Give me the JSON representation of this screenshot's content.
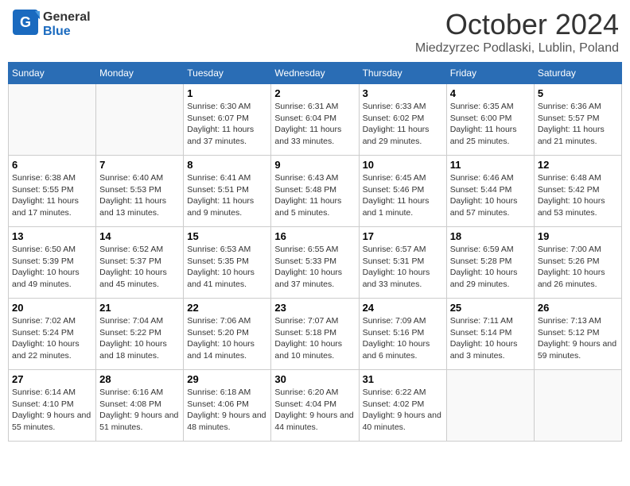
{
  "header": {
    "logo_general": "General",
    "logo_blue": "Blue",
    "month": "October 2024",
    "location": "Miedzyrzec Podlaski, Lublin, Poland"
  },
  "weekdays": [
    "Sunday",
    "Monday",
    "Tuesday",
    "Wednesday",
    "Thursday",
    "Friday",
    "Saturday"
  ],
  "weeks": [
    [
      {
        "day": "",
        "info": ""
      },
      {
        "day": "",
        "info": ""
      },
      {
        "day": "1",
        "info": "Sunrise: 6:30 AM\nSunset: 6:07 PM\nDaylight: 11 hours and 37 minutes."
      },
      {
        "day": "2",
        "info": "Sunrise: 6:31 AM\nSunset: 6:04 PM\nDaylight: 11 hours and 33 minutes."
      },
      {
        "day": "3",
        "info": "Sunrise: 6:33 AM\nSunset: 6:02 PM\nDaylight: 11 hours and 29 minutes."
      },
      {
        "day": "4",
        "info": "Sunrise: 6:35 AM\nSunset: 6:00 PM\nDaylight: 11 hours and 25 minutes."
      },
      {
        "day": "5",
        "info": "Sunrise: 6:36 AM\nSunset: 5:57 PM\nDaylight: 11 hours and 21 minutes."
      }
    ],
    [
      {
        "day": "6",
        "info": "Sunrise: 6:38 AM\nSunset: 5:55 PM\nDaylight: 11 hours and 17 minutes."
      },
      {
        "day": "7",
        "info": "Sunrise: 6:40 AM\nSunset: 5:53 PM\nDaylight: 11 hours and 13 minutes."
      },
      {
        "day": "8",
        "info": "Sunrise: 6:41 AM\nSunset: 5:51 PM\nDaylight: 11 hours and 9 minutes."
      },
      {
        "day": "9",
        "info": "Sunrise: 6:43 AM\nSunset: 5:48 PM\nDaylight: 11 hours and 5 minutes."
      },
      {
        "day": "10",
        "info": "Sunrise: 6:45 AM\nSunset: 5:46 PM\nDaylight: 11 hours and 1 minute."
      },
      {
        "day": "11",
        "info": "Sunrise: 6:46 AM\nSunset: 5:44 PM\nDaylight: 10 hours and 57 minutes."
      },
      {
        "day": "12",
        "info": "Sunrise: 6:48 AM\nSunset: 5:42 PM\nDaylight: 10 hours and 53 minutes."
      }
    ],
    [
      {
        "day": "13",
        "info": "Sunrise: 6:50 AM\nSunset: 5:39 PM\nDaylight: 10 hours and 49 minutes."
      },
      {
        "day": "14",
        "info": "Sunrise: 6:52 AM\nSunset: 5:37 PM\nDaylight: 10 hours and 45 minutes."
      },
      {
        "day": "15",
        "info": "Sunrise: 6:53 AM\nSunset: 5:35 PM\nDaylight: 10 hours and 41 minutes."
      },
      {
        "day": "16",
        "info": "Sunrise: 6:55 AM\nSunset: 5:33 PM\nDaylight: 10 hours and 37 minutes."
      },
      {
        "day": "17",
        "info": "Sunrise: 6:57 AM\nSunset: 5:31 PM\nDaylight: 10 hours and 33 minutes."
      },
      {
        "day": "18",
        "info": "Sunrise: 6:59 AM\nSunset: 5:28 PM\nDaylight: 10 hours and 29 minutes."
      },
      {
        "day": "19",
        "info": "Sunrise: 7:00 AM\nSunset: 5:26 PM\nDaylight: 10 hours and 26 minutes."
      }
    ],
    [
      {
        "day": "20",
        "info": "Sunrise: 7:02 AM\nSunset: 5:24 PM\nDaylight: 10 hours and 22 minutes."
      },
      {
        "day": "21",
        "info": "Sunrise: 7:04 AM\nSunset: 5:22 PM\nDaylight: 10 hours and 18 minutes."
      },
      {
        "day": "22",
        "info": "Sunrise: 7:06 AM\nSunset: 5:20 PM\nDaylight: 10 hours and 14 minutes."
      },
      {
        "day": "23",
        "info": "Sunrise: 7:07 AM\nSunset: 5:18 PM\nDaylight: 10 hours and 10 minutes."
      },
      {
        "day": "24",
        "info": "Sunrise: 7:09 AM\nSunset: 5:16 PM\nDaylight: 10 hours and 6 minutes."
      },
      {
        "day": "25",
        "info": "Sunrise: 7:11 AM\nSunset: 5:14 PM\nDaylight: 10 hours and 3 minutes."
      },
      {
        "day": "26",
        "info": "Sunrise: 7:13 AM\nSunset: 5:12 PM\nDaylight: 9 hours and 59 minutes."
      }
    ],
    [
      {
        "day": "27",
        "info": "Sunrise: 6:14 AM\nSunset: 4:10 PM\nDaylight: 9 hours and 55 minutes."
      },
      {
        "day": "28",
        "info": "Sunrise: 6:16 AM\nSunset: 4:08 PM\nDaylight: 9 hours and 51 minutes."
      },
      {
        "day": "29",
        "info": "Sunrise: 6:18 AM\nSunset: 4:06 PM\nDaylight: 9 hours and 48 minutes."
      },
      {
        "day": "30",
        "info": "Sunrise: 6:20 AM\nSunset: 4:04 PM\nDaylight: 9 hours and 44 minutes."
      },
      {
        "day": "31",
        "info": "Sunrise: 6:22 AM\nSunset: 4:02 PM\nDaylight: 9 hours and 40 minutes."
      },
      {
        "day": "",
        "info": ""
      },
      {
        "day": "",
        "info": ""
      }
    ]
  ]
}
